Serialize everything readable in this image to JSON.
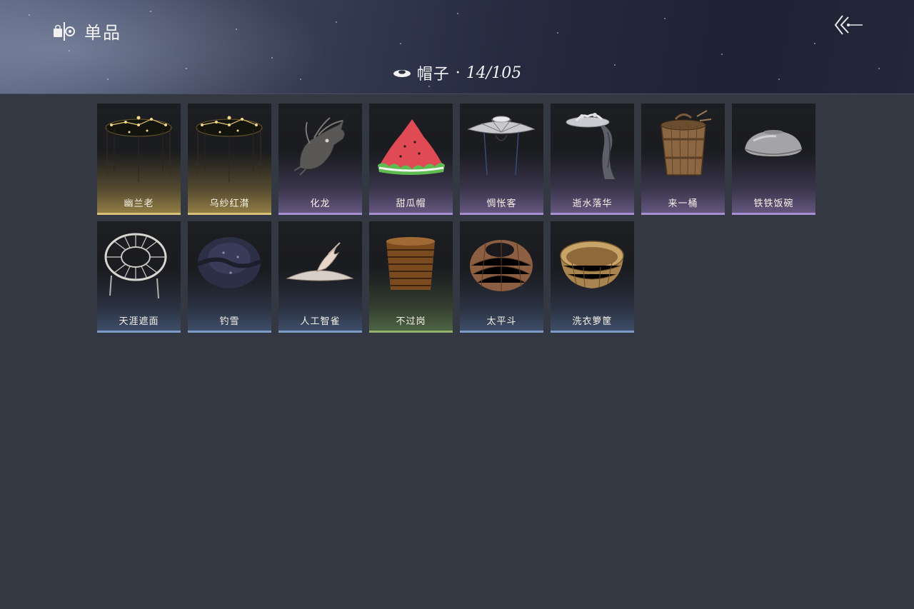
{
  "header": {
    "title": "单品",
    "title_icon": "wardrobe-icon",
    "back_icon": "back-arrow-icon"
  },
  "category": {
    "icon": "hat-icon",
    "label": "帽子",
    "separator": "·",
    "count": "14/105"
  },
  "colors": {
    "background": "#343843",
    "rarity_gold": "#d8c27a",
    "rarity_purple": "#a98fd2",
    "rarity_blue": "#7f9bc8",
    "rarity_green": "#93b06f"
  },
  "items": [
    {
      "name": "幽兰老",
      "rarity": "gold",
      "icon": "constellation-veil-hat-icon"
    },
    {
      "name": "乌纱红潸",
      "rarity": "gold",
      "icon": "constellation-veil-hat-icon"
    },
    {
      "name": "化龙",
      "rarity": "purple",
      "icon": "dragon-head-icon"
    },
    {
      "name": "甜瓜帽",
      "rarity": "purple",
      "icon": "watermelon-hat-icon"
    },
    {
      "name": "惆怅客",
      "rarity": "purple",
      "icon": "bamboo-hat-icon"
    },
    {
      "name": "逝水落华",
      "rarity": "purple",
      "icon": "cloth-hat-icon"
    },
    {
      "name": "来一桶",
      "rarity": "purple",
      "icon": "wooden-bucket-icon"
    },
    {
      "name": "铁铁饭碗",
      "rarity": "purple",
      "icon": "metal-bowl-icon"
    },
    {
      "name": "天涯遮面",
      "rarity": "blue",
      "icon": "woven-wheel-hat-icon"
    },
    {
      "name": "钓雪",
      "rarity": "blue",
      "icon": "dark-straw-hat-icon"
    },
    {
      "name": "人工智雀",
      "rarity": "blue",
      "icon": "bird-hat-icon"
    },
    {
      "name": "不过岗",
      "rarity": "green",
      "icon": "bowl-stack-icon"
    },
    {
      "name": "太平斗",
      "rarity": "blue",
      "icon": "wicker-basket-icon"
    },
    {
      "name": "洗衣箩筐",
      "rarity": "blue",
      "icon": "laundry-basket-icon"
    }
  ]
}
